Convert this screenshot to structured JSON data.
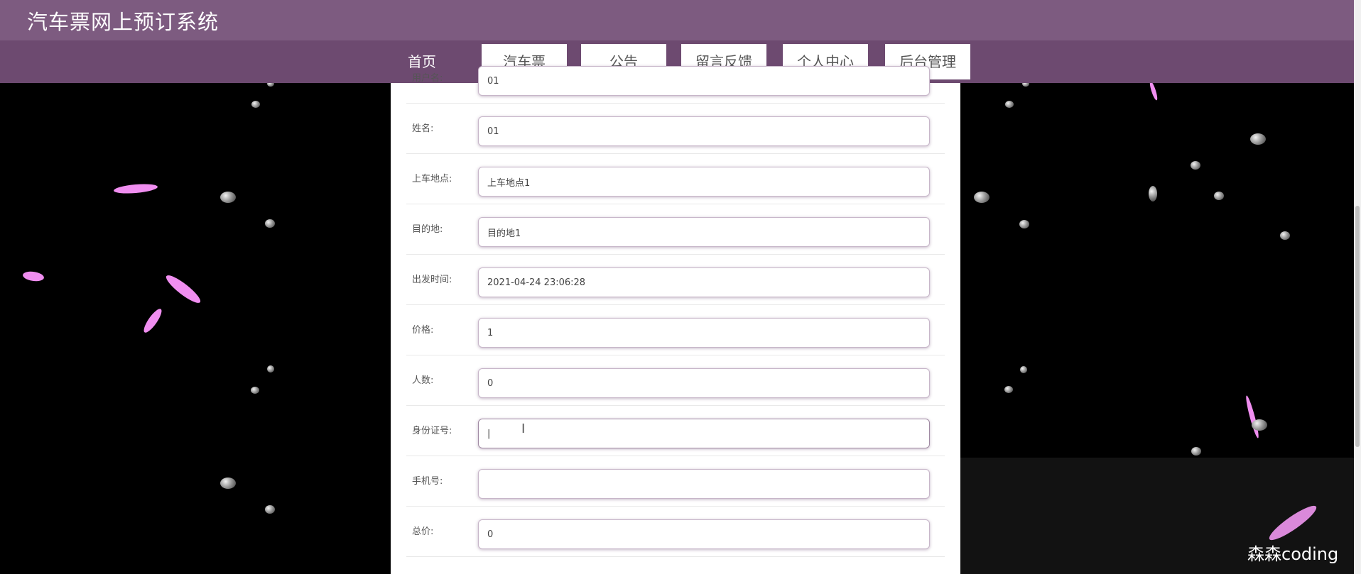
{
  "site": {
    "title": "汽车票网上预订系统"
  },
  "nav": {
    "items": [
      {
        "label": "首页"
      },
      {
        "label": "汽车票"
      },
      {
        "label": "公告"
      },
      {
        "label": "留言反馈"
      },
      {
        "label": "个人中心"
      },
      {
        "label": "后台管理"
      }
    ]
  },
  "form": {
    "rows": [
      {
        "label": "用户名:",
        "value": "01"
      },
      {
        "label": "姓名:",
        "value": "01"
      },
      {
        "label": "上车地点:",
        "value": "上车地点1"
      },
      {
        "label": "目的地:",
        "value": "目的地1"
      },
      {
        "label": "出发时间:",
        "value": "2021-04-24 23:06:28"
      },
      {
        "label": "价格:",
        "value": "1"
      },
      {
        "label": "人数:",
        "value": "0"
      },
      {
        "label": "身份证号:",
        "value": "|"
      },
      {
        "label": "手机号:",
        "value": ""
      },
      {
        "label": "总价:",
        "value": "0"
      }
    ]
  },
  "cursor": {
    "glyph": "I"
  },
  "watermark": "森森coding",
  "colors": {
    "topbar": "#7d5b80",
    "navbar": "#6d4a70",
    "petal": "#f08ef0",
    "background": "#000000"
  }
}
